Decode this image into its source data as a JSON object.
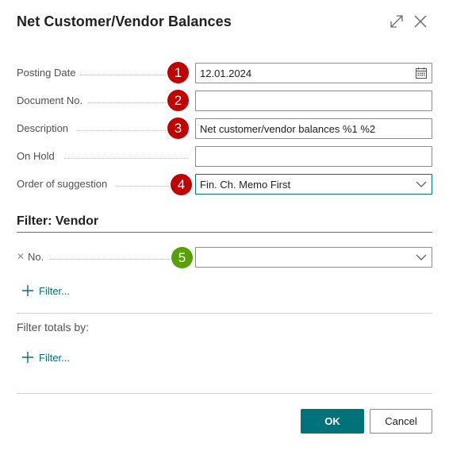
{
  "dialog": {
    "title": "Net Customer/Vendor Balances"
  },
  "fields": {
    "posting_date": {
      "label": "Posting Date",
      "value": "12.01.2024",
      "badge": "1"
    },
    "document_no": {
      "label": "Document No.",
      "value": "",
      "badge": "2"
    },
    "description": {
      "label": "Description",
      "value": "Net customer/vendor balances %1 %2",
      "badge": "3"
    },
    "on_hold": {
      "label": "On Hold",
      "value": ""
    },
    "order_of_suggestion": {
      "label": "Order of suggestion",
      "value": "Fin. Ch. Memo First",
      "badge": "4"
    }
  },
  "filter_vendor": {
    "title": "Filter: Vendor",
    "no_field": {
      "label": "No.",
      "value": "",
      "badge": "5"
    },
    "add_filter_label": "Filter..."
  },
  "filter_totals": {
    "label": "Filter totals by:",
    "add_filter_label": "Filter..."
  },
  "buttons": {
    "ok": "OK",
    "cancel": "Cancel"
  },
  "colors": {
    "accent": "#00737a",
    "badge_red": "#c00000",
    "badge_green": "#56a000"
  },
  "icons": {
    "expand": "expand-icon",
    "close": "close-icon",
    "calendar": "calendar-icon",
    "chevron": "chevron-down-icon",
    "plus": "plus-icon",
    "remove": "remove-filter-icon"
  }
}
